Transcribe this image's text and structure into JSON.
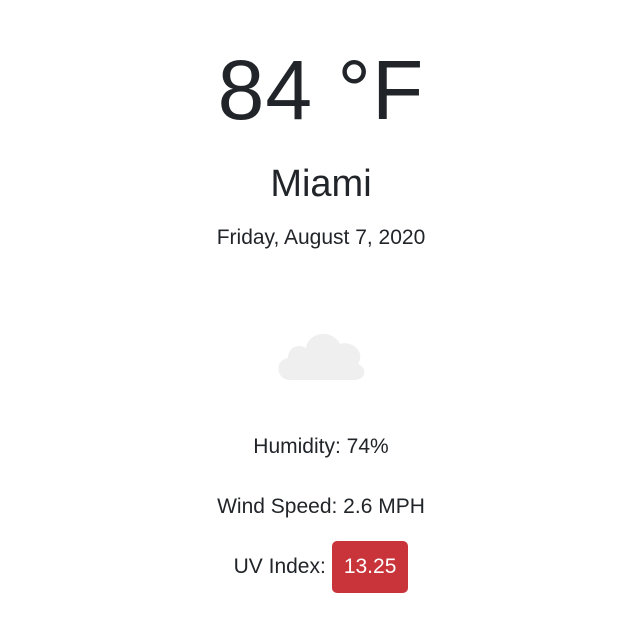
{
  "weather": {
    "temperature": "84 °F",
    "city": "Miami",
    "date": "Friday, August 7, 2020",
    "icon": "cloud-icon",
    "humidity": "Humidity: 74%",
    "wind_speed": "Wind Speed: 2.6 MPH",
    "uv_label": "UV Index:",
    "uv_value": "13.25",
    "uv_color": "#c9343a"
  }
}
